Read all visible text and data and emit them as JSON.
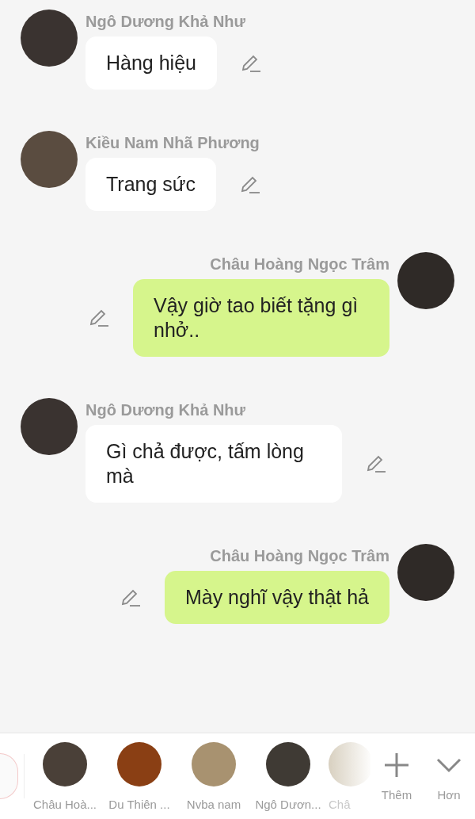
{
  "messages": [
    {
      "kind": "incoming",
      "sender": "Ngô Dương Khả Như",
      "text": "Hàng hiệu"
    },
    {
      "kind": "incoming",
      "sender": "Kiều Nam Nhã Phương",
      "text": "Trang sức"
    },
    {
      "kind": "outgoing",
      "sender": "Châu Hoàng Ngọc Trâm",
      "text": "Vậy giờ tao biết tặng gì nhở.."
    },
    {
      "kind": "incoming",
      "sender": "Ngô Dương Khả Như",
      "text": "Gì chả được, tấm lòng mà"
    },
    {
      "kind": "outgoing",
      "sender": "Châu Hoàng Ngọc Trâm",
      "text": "Mày nghĩ vậy thật hả"
    }
  ],
  "contacts": [
    {
      "name": "Châu Hoà..."
    },
    {
      "name": "Du Thiên ..."
    },
    {
      "name": "Nvba nam"
    },
    {
      "name": "Ngô Dươn..."
    },
    {
      "name": "Châ"
    }
  ],
  "actions": [
    {
      "kind": "add",
      "label": "Thêm"
    },
    {
      "kind": "more",
      "label": "Hơn"
    }
  ]
}
